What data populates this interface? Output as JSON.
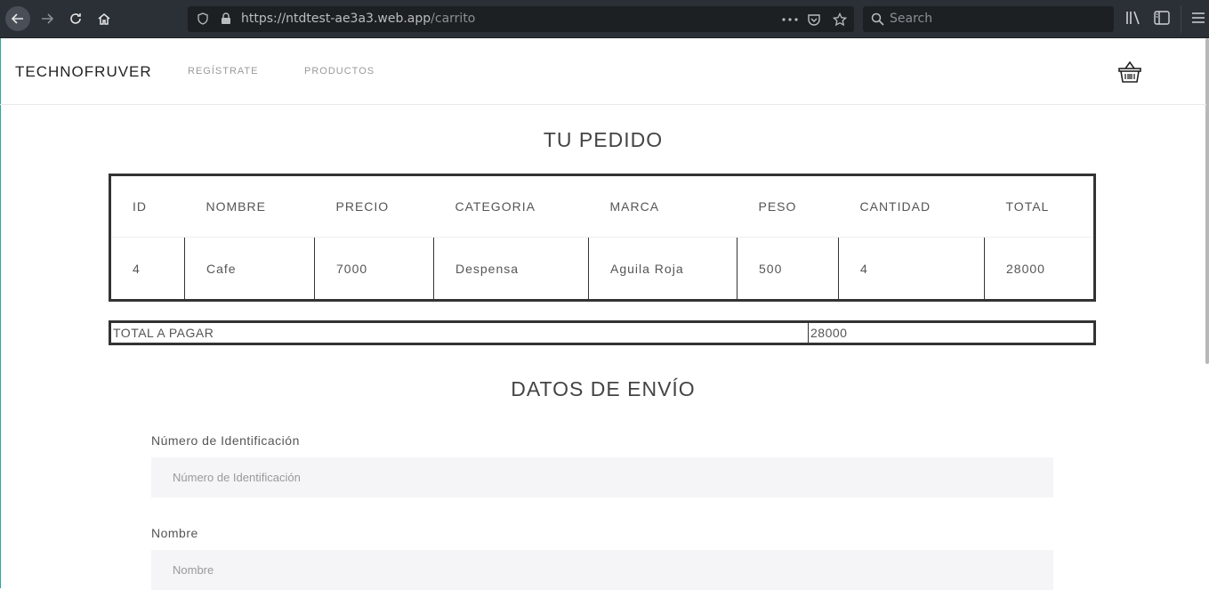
{
  "browser": {
    "url_host": "https://ntdtest-ae3a3.web.app",
    "url_path": "/carrito",
    "search_placeholder": "Search"
  },
  "navbar": {
    "brand": "TECHNOFRUVER",
    "links": [
      "REGÍSTRATE",
      "PRODUCTOS"
    ]
  },
  "order": {
    "title": "TU PEDIDO",
    "columns": [
      "ID",
      "NOMBRE",
      "PRECIO",
      "CATEGORIA",
      "MARCA",
      "PESO",
      "CANTIDAD",
      "TOTAL"
    ],
    "rows": [
      [
        "4",
        "Cafe",
        "7000",
        "Despensa",
        "Aguila Roja",
        "500",
        "4",
        "28000"
      ]
    ],
    "total_label": "TOTAL A PAGAR",
    "total_value": "28000"
  },
  "shipping": {
    "title": "DATOS DE ENVÍO",
    "fields": [
      {
        "label": "Número de Identificación",
        "placeholder": "Número de Identificación"
      },
      {
        "label": "Nombre",
        "placeholder": "Nombre"
      }
    ]
  }
}
